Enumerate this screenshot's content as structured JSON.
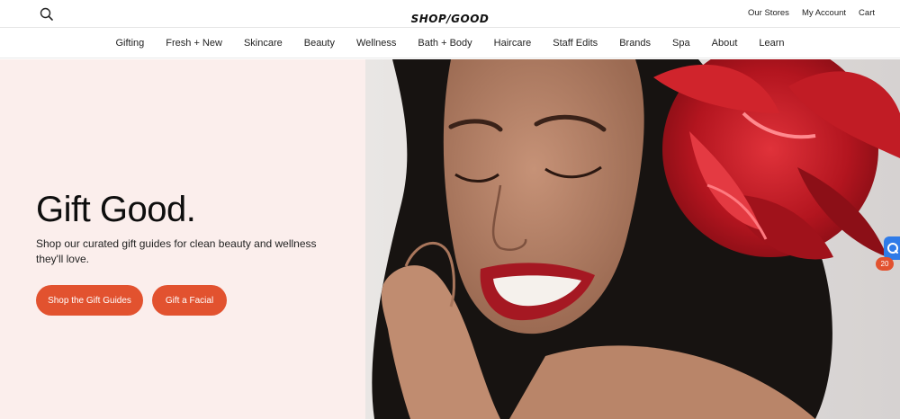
{
  "header": {
    "logo_text": "SHOP/GOOD",
    "search_icon": "search-icon",
    "links": [
      "Our Stores",
      "My Account",
      "Cart"
    ]
  },
  "nav": {
    "items": [
      "Gifting",
      "Fresh + New",
      "Skincare",
      "Beauty",
      "Wellness",
      "Bath + Body",
      "Haircare",
      "Staff Edits",
      "Brands",
      "Spa",
      "About",
      "Learn"
    ]
  },
  "hero": {
    "title": "Gift Good.",
    "subtitle": "Shop our curated gift guides for clean beauty and wellness they'll love.",
    "buttons": [
      "Shop the Gift Guides",
      "Gift a Facial"
    ],
    "image_alt": "woman-with-red-gift-bow-photo"
  },
  "chat_widget": {
    "icon": "chat-icon",
    "badge_count": "20"
  },
  "colors": {
    "accent": "#e2522f",
    "hero_bg": "#fbeeec",
    "chat_blue": "#2f7be8"
  }
}
